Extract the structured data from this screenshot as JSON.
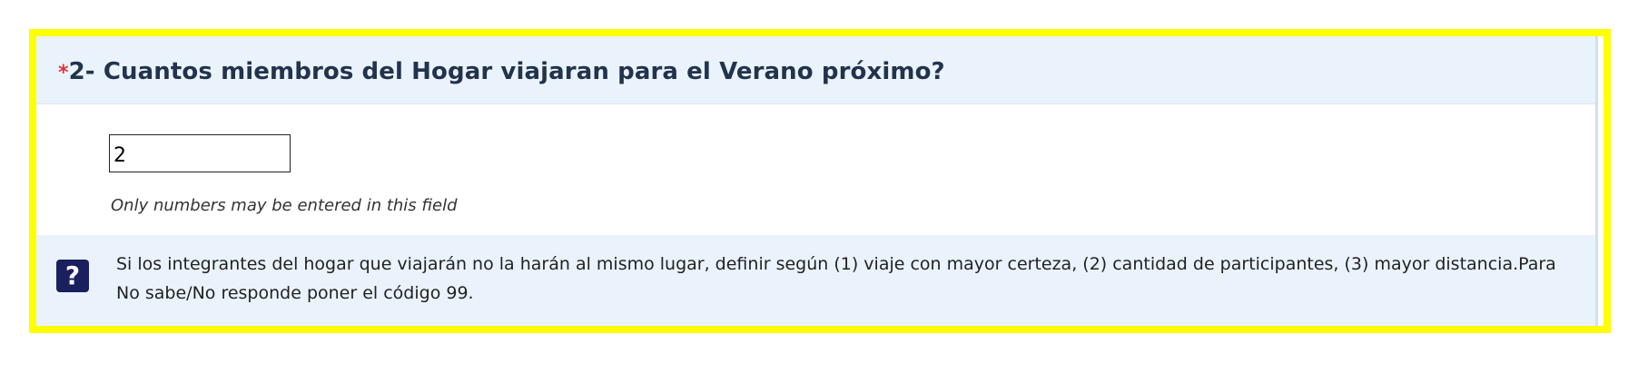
{
  "question": {
    "required_marker": "*",
    "title": "2- Cuantos miembros del Hogar viajaran para el Verano próximo?"
  },
  "answer": {
    "value": "2",
    "placeholder": ""
  },
  "validation": {
    "tip": "Only numbers may be entered in this field"
  },
  "help": {
    "icon_glyph": "?",
    "icon": "question-help-icon",
    "text": "Si los integrantes del hogar que viajarán no la harán al mismo lugar, definir según (1) viaje con mayor certeza, (2) cantidad de participantes, (3) mayor distancia.Para No sabe/No responde poner el código 99."
  },
  "colors": {
    "highlight_border": "#ffff00",
    "header_background": "#eaf3fc",
    "required_marker": "#e0333a",
    "help_icon_background": "#1a1f5e"
  }
}
